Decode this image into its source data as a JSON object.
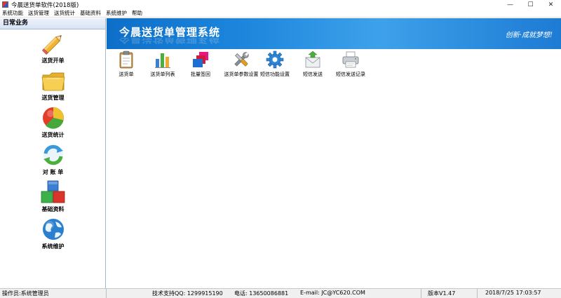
{
  "window": {
    "title": "今晨送货单软件(2018版)"
  },
  "menu": [
    "系统功能",
    "送货管理",
    "送货统计",
    "基础资料",
    "系统维护",
    "帮助"
  ],
  "sidebar": {
    "header": "日常业务",
    "items": [
      {
        "label": "送货开单",
        "icon": "pencil-icon"
      },
      {
        "label": "送货管理",
        "icon": "folder-icon"
      },
      {
        "label": "送货统计",
        "icon": "pie-chart-icon"
      },
      {
        "label": "对 账 单",
        "icon": "refresh-icon"
      },
      {
        "label": "基础资料",
        "icon": "blocks-icon"
      },
      {
        "label": "系统维护",
        "icon": "globe-icon"
      }
    ]
  },
  "banner": {
    "title": "今晨送货单管理系统",
    "slogan": "创新·成就梦想!"
  },
  "toolbar": [
    {
      "label": "送货单",
      "icon": "clipboard-icon"
    },
    {
      "label": "送货单列表",
      "icon": "bar-chart-icon"
    },
    {
      "label": "批量签回",
      "icon": "stacked-windows-icon"
    },
    {
      "label": "送货单参数设置",
      "icon": "tools-icon"
    },
    {
      "label": "短信功能设置",
      "icon": "gear-icon"
    },
    {
      "label": "短信发送",
      "icon": "mail-send-icon"
    },
    {
      "label": "短信发送记录",
      "icon": "printer-icon"
    }
  ],
  "status": {
    "operator": "操作员:系统管理员",
    "support": "技术支持QQ: 1299915190",
    "phone": "电话: 13650086881",
    "email": "E-mail: JC@YC620.COM",
    "version": "版本V1.47",
    "datetime": "2018/7/25 17:03:57"
  }
}
